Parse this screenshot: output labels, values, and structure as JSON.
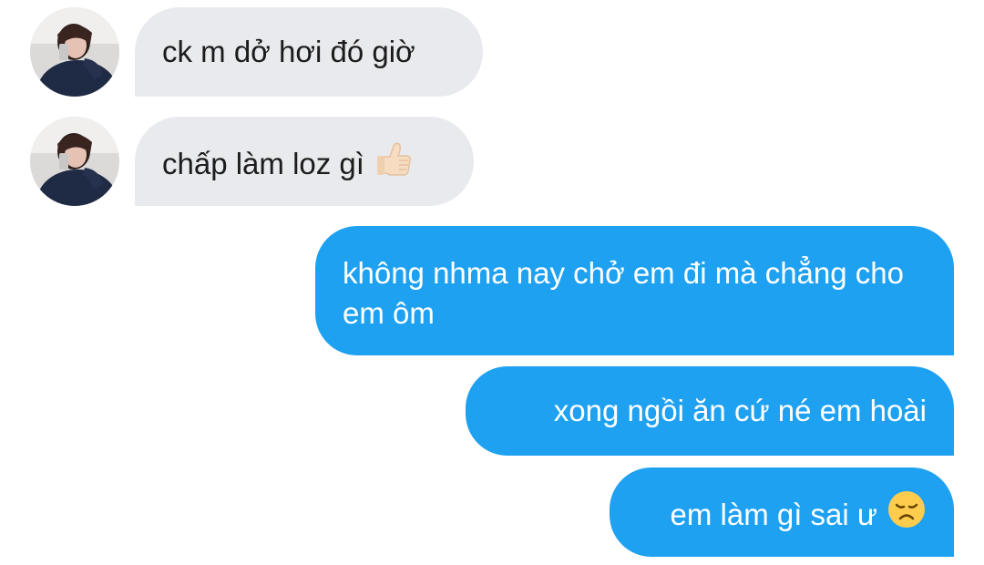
{
  "conversation": {
    "messages": [
      {
        "direction": "incoming",
        "text": "ck m dở hơi đó giờ",
        "avatar_icon": "profile-photo",
        "emoji": ""
      },
      {
        "direction": "incoming",
        "text": "chấp làm loz gì",
        "avatar_icon": "profile-photo",
        "emoji": "thumbs-up-icon"
      },
      {
        "direction": "outgoing",
        "text": "không nhma nay chở em đi mà chẳng cho em ôm",
        "emoji": ""
      },
      {
        "direction": "outgoing",
        "text": "xong ngồi ăn cứ né em hoài",
        "emoji": ""
      },
      {
        "direction": "outgoing",
        "text": "em làm gì sai ư",
        "emoji": "disappointed-face-icon"
      }
    ]
  },
  "colors": {
    "incoming_bubble": "#e9eaee",
    "outgoing_bubble": "#1ea1f1",
    "incoming_text": "#1c1c1c",
    "outgoing_text": "#ffffff"
  }
}
